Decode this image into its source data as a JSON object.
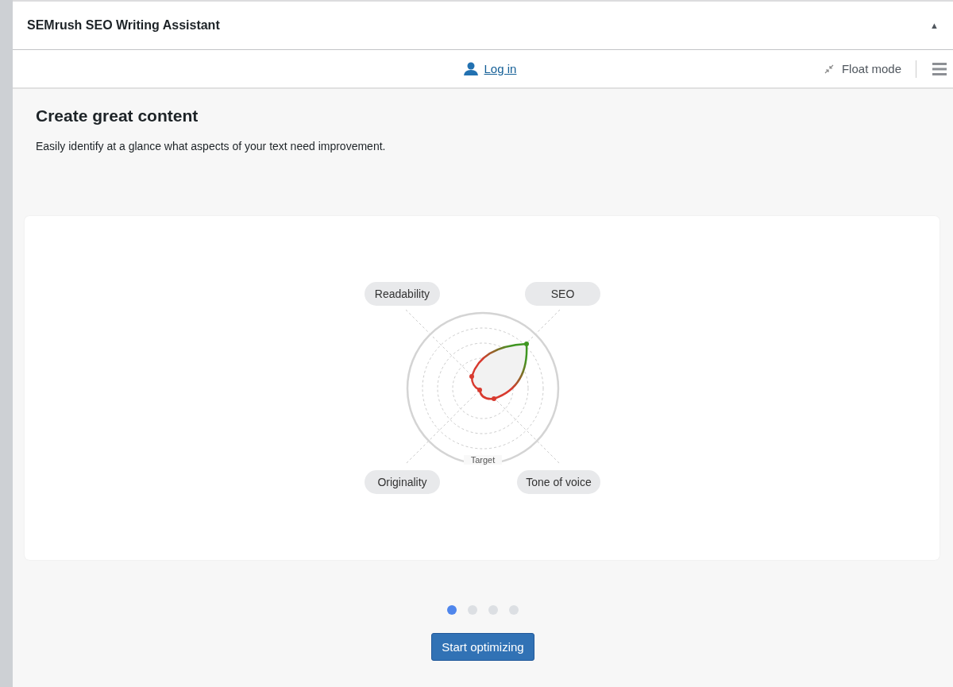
{
  "panel": {
    "title": "SEMrush SEO Writing Assistant",
    "collapse_glyph": "▲"
  },
  "toolbar": {
    "login": "Log in",
    "float_mode": "Float mode"
  },
  "intro": {
    "heading": "Create great content",
    "text": "Easily identify at a glance what aspects of your text need improvement."
  },
  "chart": {
    "labels": [
      "Readability",
      "SEO",
      "Originality",
      "Tone of voice"
    ],
    "target": "Target"
  },
  "slides": [
    {
      "selected": true
    },
    {
      "selected": false
    },
    {
      "selected": false
    },
    {
      "selected": false
    }
  ],
  "button": "Start optimizing"
}
